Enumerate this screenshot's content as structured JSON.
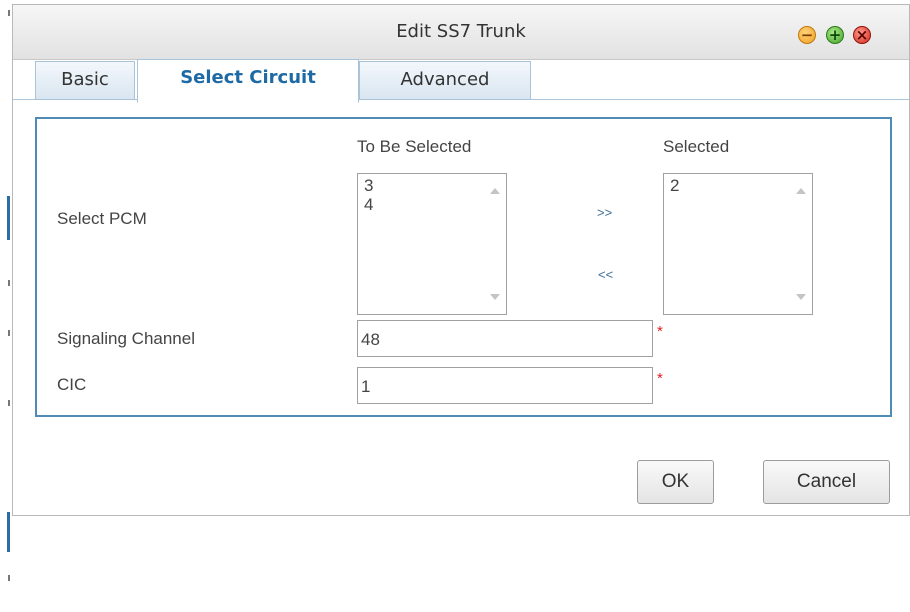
{
  "dialog": {
    "title": "Edit SS7 Trunk",
    "window_buttons": {
      "minimize": "−",
      "maximize": "+",
      "close": "×"
    }
  },
  "tabs": [
    {
      "label": "Basic",
      "active": false
    },
    {
      "label": "Select Circuit",
      "active": true
    },
    {
      "label": "Advanced",
      "active": false
    }
  ],
  "select_pcm": {
    "label": "Select PCM",
    "to_be_selected_header": "To Be Selected",
    "selected_header": "Selected",
    "to_be_selected_items": [
      "3",
      "4"
    ],
    "selected_items": [
      "2"
    ],
    "add_label": ">>",
    "remove_label": "<<"
  },
  "signaling_channel": {
    "label": "Signaling Channel",
    "value": "48",
    "required_mark": "*"
  },
  "cic": {
    "label": "CIC",
    "value": "1",
    "required_mark": "*"
  },
  "buttons": {
    "ok": "OK",
    "cancel": "Cancel"
  },
  "colors": {
    "accent": "#1d6aa5",
    "panel_border": "#4f8bb4",
    "required": "#e02020"
  }
}
